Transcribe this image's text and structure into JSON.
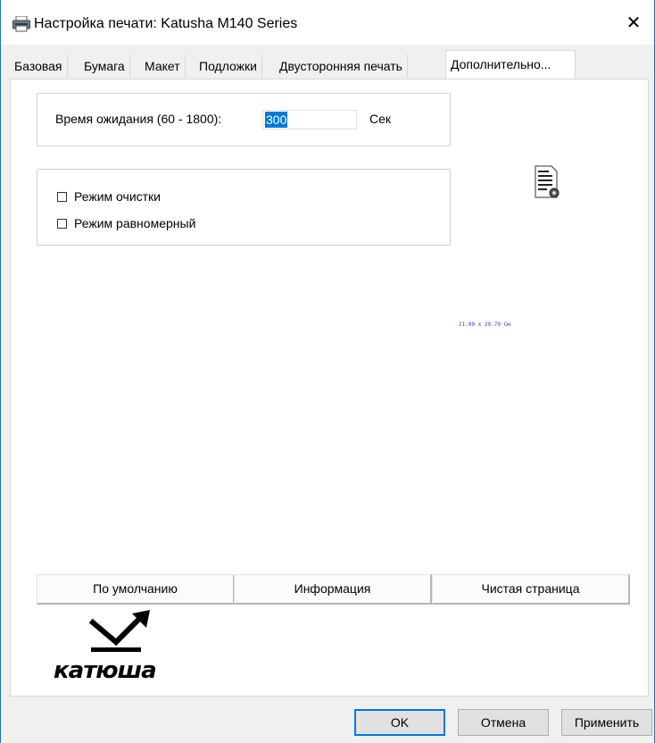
{
  "window": {
    "title": "Настройка печати: Katusha M140 Series",
    "close_symbol": "✕"
  },
  "tabs": [
    {
      "label": "Базовая",
      "active": false
    },
    {
      "label": "Бумага",
      "active": false
    },
    {
      "label": "Макет",
      "active": false
    },
    {
      "label": "Подложки",
      "active": false
    },
    {
      "label": "Двусторонняя печать",
      "active": false
    },
    {
      "label": "Дополнительно...",
      "active": true
    }
  ],
  "timeout": {
    "label": "Время ожидания (60 - 1800):",
    "value": "300",
    "unit": "Сек"
  },
  "options": [
    {
      "label": "Режим очистки",
      "checked": false
    },
    {
      "label": "Режим равномерный",
      "checked": false
    }
  ],
  "preview": {
    "icon": "document-printer-icon",
    "paper_size": "21.00 x 29.70 См"
  },
  "buttons": {
    "defaults": "По умолчанию",
    "info": "Информация",
    "clean_page": "Чистая страница"
  },
  "logo": {
    "text": "катюша"
  },
  "footer": {
    "ok": "OK",
    "cancel": "Отмена",
    "apply": "Применить"
  },
  "colors": {
    "accent": "#0078d7",
    "paper_size_text": "#3a3ad9"
  }
}
